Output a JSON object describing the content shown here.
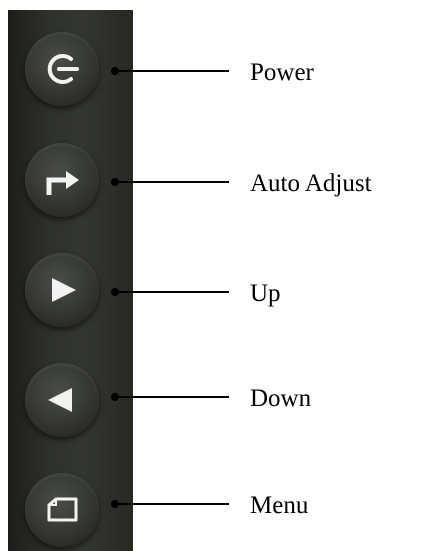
{
  "buttons": [
    {
      "label": "Power",
      "icon": "power-icon"
    },
    {
      "label": "Auto Adjust",
      "icon": "auto-adjust-arrow-icon"
    },
    {
      "label": "Up",
      "icon": "triangle-right-icon"
    },
    {
      "label": "Down",
      "icon": "triangle-left-icon"
    },
    {
      "label": "Menu",
      "icon": "menu-card-icon"
    }
  ],
  "colors": {
    "panel": "#2e312c",
    "button": "#383b35",
    "icon": "#f2f2f2",
    "line": "#000000"
  }
}
